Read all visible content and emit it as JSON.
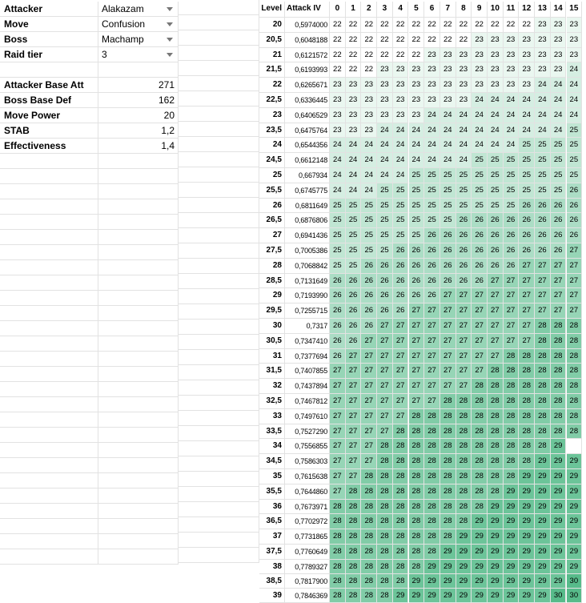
{
  "settings": [
    {
      "label": "Attacker",
      "value": "Alakazam"
    },
    {
      "label": "Move",
      "value": "Confusion"
    },
    {
      "label": "Boss",
      "value": "Machamp"
    },
    {
      "label": "Raid tier",
      "value": "3"
    }
  ],
  "stats": [
    {
      "label": "Attacker Base Att",
      "value": "271"
    },
    {
      "label": "Boss Base Def",
      "value": "162"
    },
    {
      "label": "Move Power",
      "value": "20"
    },
    {
      "label": "STAB",
      "value": "1,2"
    },
    {
      "label": "Effectiveness",
      "value": "1,4"
    }
  ],
  "table": {
    "level_header": "Level",
    "attack_header": "Attack IV",
    "iv_headers": [
      "0",
      "1",
      "2",
      "3",
      "4",
      "5",
      "6",
      "7",
      "8",
      "9",
      "10",
      "11",
      "12",
      "13",
      "14",
      "15"
    ],
    "rows": [
      {
        "level": "20",
        "cpm": "0,5974000",
        "damage": [
          22,
          22,
          22,
          22,
          22,
          22,
          22,
          22,
          22,
          22,
          22,
          22,
          22,
          23,
          23,
          23
        ]
      },
      {
        "level": "20,5",
        "cpm": "0,6048188",
        "damage": [
          22,
          22,
          22,
          22,
          22,
          22,
          22,
          22,
          22,
          23,
          23,
          23,
          23,
          23,
          23,
          23
        ]
      },
      {
        "level": "21",
        "cpm": "0,6121572",
        "damage": [
          22,
          22,
          22,
          22,
          22,
          22,
          23,
          23,
          23,
          23,
          23,
          23,
          23,
          23,
          23,
          23
        ]
      },
      {
        "level": "21,5",
        "cpm": "0,6193993",
        "damage": [
          22,
          22,
          22,
          23,
          23,
          23,
          23,
          23,
          23,
          23,
          23,
          23,
          23,
          23,
          23,
          24
        ]
      },
      {
        "level": "22",
        "cpm": "0,6265671",
        "damage": [
          23,
          23,
          23,
          23,
          23,
          23,
          23,
          23,
          23,
          23,
          23,
          23,
          23,
          24,
          24,
          24
        ]
      },
      {
        "level": "22,5",
        "cpm": "0,6336445",
        "damage": [
          23,
          23,
          23,
          23,
          23,
          23,
          23,
          23,
          23,
          24,
          24,
          24,
          24,
          24,
          24,
          24
        ]
      },
      {
        "level": "23",
        "cpm": "0,6406529",
        "damage": [
          23,
          23,
          23,
          23,
          23,
          23,
          24,
          24,
          24,
          24,
          24,
          24,
          24,
          24,
          24,
          24
        ]
      },
      {
        "level": "23,5",
        "cpm": "0,6475764",
        "damage": [
          23,
          23,
          23,
          24,
          24,
          24,
          24,
          24,
          24,
          24,
          24,
          24,
          24,
          24,
          24,
          25
        ]
      },
      {
        "level": "24",
        "cpm": "0,6544356",
        "damage": [
          24,
          24,
          24,
          24,
          24,
          24,
          24,
          24,
          24,
          24,
          24,
          24,
          25,
          25,
          25,
          25
        ]
      },
      {
        "level": "24,5",
        "cpm": "0,6612148",
        "damage": [
          24,
          24,
          24,
          24,
          24,
          24,
          24,
          24,
          24,
          25,
          25,
          25,
          25,
          25,
          25,
          25
        ]
      },
      {
        "level": "25",
        "cpm": "0,667934",
        "damage": [
          24,
          24,
          24,
          24,
          24,
          25,
          25,
          25,
          25,
          25,
          25,
          25,
          25,
          25,
          25,
          25
        ]
      },
      {
        "level": "25,5",
        "cpm": "0,6745775",
        "damage": [
          24,
          24,
          24,
          25,
          25,
          25,
          25,
          25,
          25,
          25,
          25,
          25,
          25,
          25,
          25,
          26
        ]
      },
      {
        "level": "26",
        "cpm": "0,6811649",
        "damage": [
          25,
          25,
          25,
          25,
          25,
          25,
          25,
          25,
          25,
          25,
          25,
          25,
          26,
          26,
          26,
          26
        ]
      },
      {
        "level": "26,5",
        "cpm": "0,6876806",
        "damage": [
          25,
          25,
          25,
          25,
          25,
          25,
          25,
          25,
          26,
          26,
          26,
          26,
          26,
          26,
          26,
          26
        ]
      },
      {
        "level": "27",
        "cpm": "0,6941436",
        "damage": [
          25,
          25,
          25,
          25,
          25,
          25,
          26,
          26,
          26,
          26,
          26,
          26,
          26,
          26,
          26,
          26
        ]
      },
      {
        "level": "27,5",
        "cpm": "0,7005386",
        "damage": [
          25,
          25,
          25,
          25,
          26,
          26,
          26,
          26,
          26,
          26,
          26,
          26,
          26,
          26,
          26,
          27
        ]
      },
      {
        "level": "28",
        "cpm": "0,7068842",
        "damage": [
          25,
          25,
          26,
          26,
          26,
          26,
          26,
          26,
          26,
          26,
          26,
          26,
          27,
          27,
          27,
          27
        ]
      },
      {
        "level": "28,5",
        "cpm": "0,7131649",
        "damage": [
          26,
          26,
          26,
          26,
          26,
          26,
          26,
          26,
          26,
          26,
          27,
          27,
          27,
          27,
          27,
          27
        ]
      },
      {
        "level": "29",
        "cpm": "0,7193990",
        "damage": [
          26,
          26,
          26,
          26,
          26,
          26,
          26,
          27,
          27,
          27,
          27,
          27,
          27,
          27,
          27,
          27
        ]
      },
      {
        "level": "29,5",
        "cpm": "0,7255715",
        "damage": [
          26,
          26,
          26,
          26,
          26,
          27,
          27,
          27,
          27,
          27,
          27,
          27,
          27,
          27,
          27,
          27
        ]
      },
      {
        "level": "30",
        "cpm": "0,7317",
        "damage": [
          26,
          26,
          26,
          27,
          27,
          27,
          27,
          27,
          27,
          27,
          27,
          27,
          27,
          28,
          28,
          28
        ]
      },
      {
        "level": "30,5",
        "cpm": "0,7347410",
        "damage": [
          26,
          26,
          27,
          27,
          27,
          27,
          27,
          27,
          27,
          27,
          27,
          27,
          27,
          28,
          28,
          28
        ]
      },
      {
        "level": "31",
        "cpm": "0,7377694",
        "damage": [
          26,
          27,
          27,
          27,
          27,
          27,
          27,
          27,
          27,
          27,
          27,
          28,
          28,
          28,
          28,
          28
        ]
      },
      {
        "level": "31,5",
        "cpm": "0,7407855",
        "damage": [
          27,
          27,
          27,
          27,
          27,
          27,
          27,
          27,
          27,
          27,
          28,
          28,
          28,
          28,
          28,
          28
        ]
      },
      {
        "level": "32",
        "cpm": "0,7437894",
        "damage": [
          27,
          27,
          27,
          27,
          27,
          27,
          27,
          27,
          27,
          28,
          28,
          28,
          28,
          28,
          28,
          28
        ]
      },
      {
        "level": "32,5",
        "cpm": "0,7467812",
        "damage": [
          27,
          27,
          27,
          27,
          27,
          27,
          27,
          28,
          28,
          28,
          28,
          28,
          28,
          28,
          28,
          28
        ]
      },
      {
        "level": "33",
        "cpm": "0,7497610",
        "damage": [
          27,
          27,
          27,
          27,
          27,
          28,
          28,
          28,
          28,
          28,
          28,
          28,
          28,
          28,
          28,
          28
        ]
      },
      {
        "level": "33,5",
        "cpm": "0,7527290",
        "damage": [
          27,
          27,
          27,
          27,
          28,
          28,
          28,
          28,
          28,
          28,
          28,
          28,
          28,
          28,
          28,
          28
        ]
      },
      {
        "level": "34",
        "cpm": "0,7556855",
        "damage": [
          27,
          27,
          27,
          28,
          28,
          28,
          28,
          28,
          28,
          28,
          28,
          28,
          28,
          28,
          29,
          null
        ]
      },
      {
        "level": "34,5",
        "cpm": "0,7586303",
        "damage": [
          27,
          27,
          27,
          28,
          28,
          28,
          28,
          28,
          28,
          28,
          28,
          28,
          28,
          29,
          29,
          29
        ]
      },
      {
        "level": "35",
        "cpm": "0,7615638",
        "damage": [
          27,
          27,
          28,
          28,
          28,
          28,
          28,
          28,
          28,
          28,
          28,
          28,
          29,
          29,
          29,
          29
        ]
      },
      {
        "level": "35,5",
        "cpm": "0,7644860",
        "damage": [
          27,
          28,
          28,
          28,
          28,
          28,
          28,
          28,
          28,
          28,
          28,
          29,
          29,
          29,
          29,
          29
        ]
      },
      {
        "level": "36",
        "cpm": "0,7673971",
        "damage": [
          28,
          28,
          28,
          28,
          28,
          28,
          28,
          28,
          28,
          28,
          29,
          29,
          29,
          29,
          29,
          29
        ]
      },
      {
        "level": "36,5",
        "cpm": "0,7702972",
        "damage": [
          28,
          28,
          28,
          28,
          28,
          28,
          28,
          28,
          28,
          29,
          29,
          29,
          29,
          29,
          29,
          29
        ]
      },
      {
        "level": "37",
        "cpm": "0,7731865",
        "damage": [
          28,
          28,
          28,
          28,
          28,
          28,
          28,
          28,
          29,
          29,
          29,
          29,
          29,
          29,
          29,
          29
        ]
      },
      {
        "level": "37,5",
        "cpm": "0,7760649",
        "damage": [
          28,
          28,
          28,
          28,
          28,
          28,
          28,
          29,
          29,
          29,
          29,
          29,
          29,
          29,
          29,
          29
        ]
      },
      {
        "level": "38",
        "cpm": "0,7789327",
        "damage": [
          28,
          28,
          28,
          28,
          28,
          28,
          29,
          29,
          29,
          29,
          29,
          29,
          29,
          29,
          29,
          29
        ]
      },
      {
        "level": "38,5",
        "cpm": "0,7817900",
        "damage": [
          28,
          28,
          28,
          28,
          28,
          29,
          29,
          29,
          29,
          29,
          29,
          29,
          29,
          29,
          29,
          30
        ]
      },
      {
        "level": "39",
        "cpm": "0,7846369",
        "damage": [
          28,
          28,
          28,
          28,
          29,
          29,
          29,
          29,
          29,
          29,
          29,
          29,
          29,
          29,
          30,
          30
        ]
      }
    ]
  },
  "colors": {
    "scale_min": "#ffffff",
    "scale_max": "#57bb8a",
    "gridline": "#e2e2e2",
    "dropdown_arrow": "#777777"
  }
}
